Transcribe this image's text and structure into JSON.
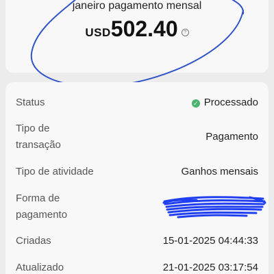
{
  "summary": {
    "title": "janeiro pagamento mensal",
    "currency": "USD",
    "amount": "502.40",
    "info_icon": "?"
  },
  "details": {
    "status": {
      "label": "Status",
      "value": "Processado",
      "icon": "check-circle-icon",
      "color": "#4ab36d"
    },
    "transaction_type": {
      "label_line1": "Tipo de",
      "label_line2": "transação",
      "value": "Pagamento"
    },
    "activity_type": {
      "label": "Tipo de atividade",
      "value": "Ganhos mensais"
    },
    "payment_method": {
      "label_line1": "Forma de",
      "label_line2": "pagamento"
    },
    "created": {
      "label": "Criadas",
      "value": "15-01-2025 04:44:33"
    },
    "updated": {
      "label": "Atualizado",
      "value": "21-01-2025 03:17:54"
    }
  },
  "colors": {
    "annotation_blue": "#2f52c8"
  }
}
